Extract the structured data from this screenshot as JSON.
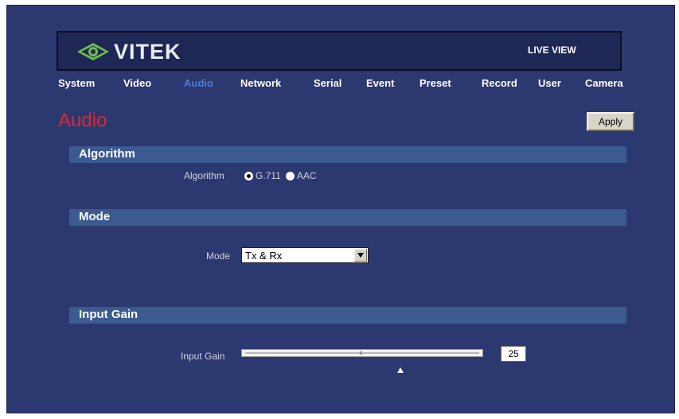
{
  "header": {
    "brand": "VITEK",
    "live_view": "LIVE VIEW"
  },
  "nav": {
    "items": [
      {
        "label": "System"
      },
      {
        "label": "Video"
      },
      {
        "label": "Audio",
        "active": true
      },
      {
        "label": "Network"
      },
      {
        "label": "Serial"
      },
      {
        "label": "Event"
      },
      {
        "label": "Preset"
      },
      {
        "label": "Record"
      },
      {
        "label": "User"
      },
      {
        "label": "Camera"
      }
    ]
  },
  "page": {
    "title": "Audio",
    "apply_label": "Apply"
  },
  "sections": {
    "algorithm": {
      "title": "Algorithm",
      "label": "Algorithm",
      "options": [
        "G.711",
        "AAC"
      ],
      "selected": "G.711"
    },
    "mode": {
      "title": "Mode",
      "label": "Mode",
      "value": "Tx & Rx"
    },
    "input_gain": {
      "title": "Input Gain",
      "label": "Input Gain",
      "value": "25"
    }
  },
  "colors": {
    "background": "#2c3870",
    "section_bar": "#3b5a90",
    "title_red": "#e0282e",
    "nav_active": "#4c7cd4",
    "logo_green": "#6cc04a"
  },
  "icons": {
    "logo": "eye-logo-icon",
    "dropdown": "chevron-down-icon"
  }
}
